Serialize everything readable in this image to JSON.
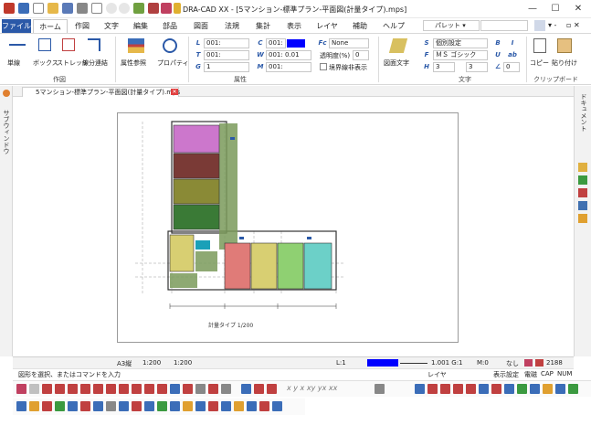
{
  "window": {
    "title": "DRA-CAD XX - [5マンション-標準プラン-平面図(計量タイプ).mps]",
    "minimize": "—",
    "maximize": "☐",
    "close": "✕"
  },
  "tabs": [
    "ファイル",
    "ホーム",
    "作図",
    "文字",
    "編集",
    "部品",
    "図面",
    "法規",
    "集計",
    "表示",
    "レイヤ",
    "補助",
    "ヘルプ"
  ],
  "pallet_label": "パレット ▾",
  "ribbon": {
    "draw_buttons": [
      "単線",
      "ボックス",
      "ストレッチ",
      "線分連結"
    ],
    "draw_group_label": "作図",
    "ref_buttons": [
      "属性参照",
      "プロパティ"
    ],
    "attr": {
      "layer": "001:",
      "line_type": "001:",
      "line_color_label": "001:",
      "line_width": "001: 0.01",
      "group": "1",
      "mode": "001:",
      "fill": "None",
      "opacity_label": "透明度(%)",
      "opacity_value": "0",
      "hide_boundary": "境界線非表示",
      "group_label": "属性"
    },
    "text": {
      "apply_button": "図面文字",
      "style": "個別設定",
      "font": "ＭＳ ゴシック",
      "size1": "3",
      "size2": "3",
      "size3": "0",
      "group_label": "文字"
    },
    "clipboard": {
      "copy": "コピー",
      "paste": "貼り付け",
      "group_label": "クリップボード"
    }
  },
  "document_tab": "5マンション-標準プラン-平面図(計量タイプ).mps",
  "left_panel_label": "サブウィンドウ",
  "right_panel_label": "ドキュメント",
  "drawing_caption": "計量タイプ 1/200",
  "status1": {
    "scale_label": "A3縦",
    "scale1": "1:200",
    "scale2": "1:200",
    "layer_field": "L:1",
    "ratio": "1.001 G:1",
    "mode": "M:0",
    "none": "なし",
    "count": "2188"
  },
  "status2": {
    "message": "図形を選択、またはコマンドを入力",
    "layer_label": "レイヤ",
    "display_settings": "表示設定",
    "cap": "CAP",
    "num": "NUM",
    "kana": "電磁"
  },
  "colors": {
    "accent": "#2b59a8",
    "room_magenta": "#cc77cc",
    "room_brown": "#7a3a36",
    "room_olive": "#8a8a36",
    "room_green": "#3a7a36",
    "room_red": "#e07b78",
    "room_yellow": "#d8cf72",
    "room_lime": "#8fd072",
    "room_cyan": "#6cd0c8",
    "room_teal": "#1aa0b8",
    "hatch_green": "#7a9a5a"
  }
}
